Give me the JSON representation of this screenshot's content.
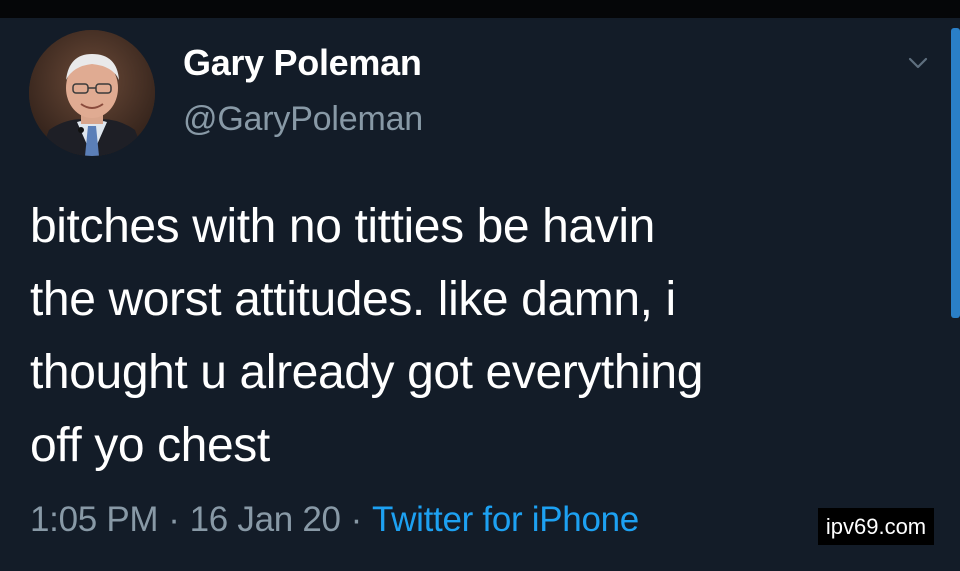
{
  "tweet": {
    "display_name": "Gary Poleman",
    "handle": "@GaryPoleman",
    "text_lines": [
      "bitches with no titties be havin",
      "the worst attitudes. like damn, i",
      "thought u already got everything",
      "off yo chest"
    ],
    "time": "1:05 PM",
    "date": "16 Jan 20",
    "source": "Twitter for iPhone",
    "separator": "·"
  },
  "icons": {
    "more_menu": "chevron-down-icon",
    "avatar": "profile-photo"
  },
  "watermark": {
    "text": "ipv69.com"
  },
  "colors": {
    "background": "#131c28",
    "text": "#ffffff",
    "muted": "#8899a6",
    "link": "#1da1f2",
    "scrollbar": "#2a7fc7"
  }
}
